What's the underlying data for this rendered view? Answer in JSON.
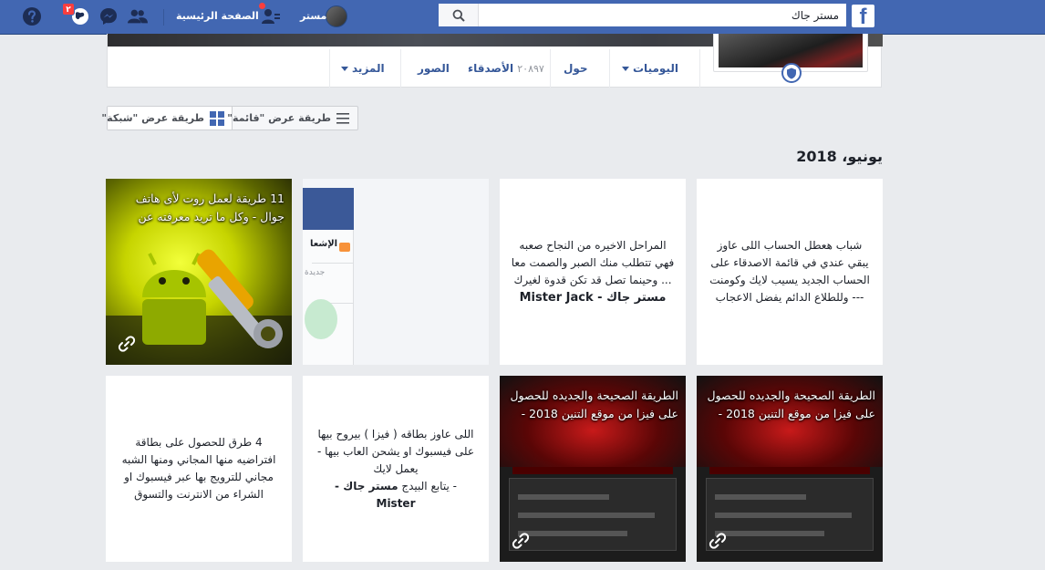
{
  "topbar": {
    "logo": "f",
    "search_value": "مستر جاك",
    "profile_name": "مستر",
    "home_label": "الصفحة الرئيسية",
    "notif_count": "٢"
  },
  "tabs": [
    {
      "label": "اليوميات"
    },
    {
      "label": "حول"
    },
    {
      "label": "الأصدقاء",
      "count": "٢٠٨٩٧"
    },
    {
      "label": "الصور"
    },
    {
      "label": "المزيد"
    }
  ],
  "view": {
    "list_label": "طريقة عرض \"قائمة\"",
    "grid_label": "طريقة عرض \"شبكة\""
  },
  "section_date": "يونيو، 2018",
  "posts": {
    "p1": {
      "text": "شباب هعطل الحساب اللى عاوز يبقي عندي في قائمة الاصدقاء على الحساب الجديد يسيب لايك وكومنت --- وللطلاع الدائم يفضل الاعجاب"
    },
    "p2": {
      "text": "المراحل الاخيره من النجاح صعبه فهي تتطلب منك الصبر والصمت معا ... وحينما تصل قد تكن قدوة لغيرك",
      "author": "مستر جاك - Mister Jack"
    },
    "p3": {
      "tab1": "الإشعا",
      "tab2": "جديدة"
    },
    "p4": {
      "text": "11 طريقة لعمل روت لأى هاتف جوال - وكل ما تريد معرفته عن"
    },
    "p5": {
      "text": "الطريقة الصحيحة والجديده للحصول على فيزا من موقع التنين 2018 -"
    },
    "p6": {
      "text": "الطريقة الصحيحة والجديده للحصول على فيزا من موقع التنين 2018 -"
    },
    "p7": {
      "text": "اللى عاوز بطاقه ( فيزا ) بيروح بيها على فيسبوك او يشحن العاب بيها - يعمل لايك",
      "text2": "- يتابع البيدج",
      "author": "مستر جاك - Mister"
    },
    "p8": {
      "text": "4 طرق للحصول على بطاقة افتراضيه منها المجاني ومنها الشبه مجاني للترويج بها عبر فيسبوك او الشراء من الانترنت والتسوق"
    }
  },
  "colors": {
    "brand": "#4267b2",
    "link": "#365899",
    "background": "#e9ebee"
  }
}
